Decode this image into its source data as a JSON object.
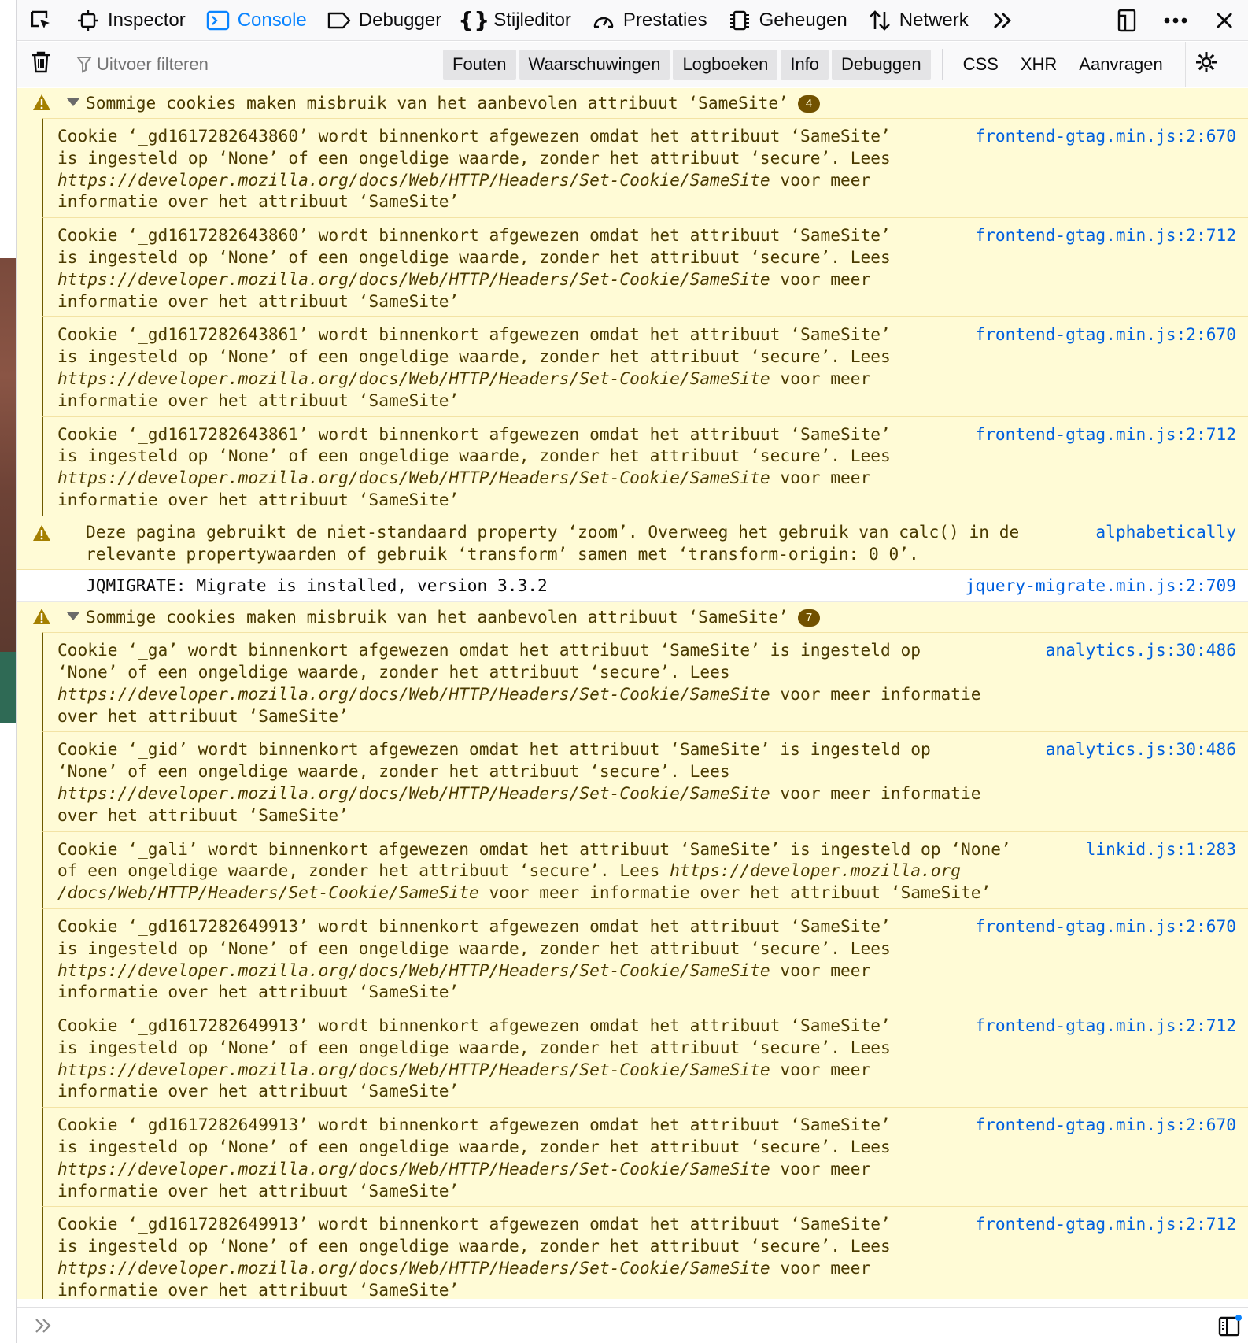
{
  "toolbar": {
    "tabs": [
      {
        "label": "Inspector",
        "icon": "inspector-icon"
      },
      {
        "label": "Console",
        "icon": "console-icon",
        "active": true
      },
      {
        "label": "Debugger",
        "icon": "debugger-icon"
      },
      {
        "label": "Stijleditor",
        "icon": "style-editor-icon"
      },
      {
        "label": "Prestaties",
        "icon": "performance-icon"
      },
      {
        "label": "Geheugen",
        "icon": "memory-icon"
      },
      {
        "label": "Netwerk",
        "icon": "network-icon"
      }
    ],
    "accent": "#0a84ff"
  },
  "filterbar": {
    "placeholder": "Uitvoer filteren",
    "levels": [
      "Fouten",
      "Waarschuwingen",
      "Logboeken",
      "Info",
      "Debuggen"
    ],
    "types": [
      "CSS",
      "XHR",
      "Aanvragen"
    ]
  },
  "output": {
    "group1": {
      "title": "Sommige cookies maken misbruik van het aanbevolen attribuut ‘SameSite’",
      "count": "4",
      "items": [
        {
          "lines": [
            "Cookie ‘_gd1617282643860’ wordt binnenkort afgewezen omdat het attribuut ‘SameSite’",
            "is ingesteld op ‘None’ of een ongeldige waarde, zonder het attribuut ‘secure’. Lees",
            "https://developer.mozilla.org/docs/Web/HTTP/Headers/Set-Cookie/SameSite",
            "informatie over het attribuut ‘SameSite’"
          ],
          "tail": " voor meer",
          "source": "frontend-gtag.min.js:2:670"
        },
        {
          "lines": [
            "Cookie ‘_gd1617282643860’ wordt binnenkort afgewezen omdat het attribuut ‘SameSite’",
            "is ingesteld op ‘None’ of een ongeldige waarde, zonder het attribuut ‘secure’. Lees",
            "https://developer.mozilla.org/docs/Web/HTTP/Headers/Set-Cookie/SameSite",
            "informatie over het attribuut ‘SameSite’"
          ],
          "tail": " voor meer",
          "source": "frontend-gtag.min.js:2:712"
        },
        {
          "lines": [
            "Cookie ‘_gd1617282643861’ wordt binnenkort afgewezen omdat het attribuut ‘SameSite’",
            "is ingesteld op ‘None’ of een ongeldige waarde, zonder het attribuut ‘secure’. Lees",
            "https://developer.mozilla.org/docs/Web/HTTP/Headers/Set-Cookie/SameSite",
            "informatie over het attribuut ‘SameSite’"
          ],
          "tail": " voor meer",
          "source": "frontend-gtag.min.js:2:670"
        },
        {
          "lines": [
            "Cookie ‘_gd1617282643861’ wordt binnenkort afgewezen omdat het attribuut ‘SameSite’",
            "is ingesteld op ‘None’ of een ongeldige waarde, zonder het attribuut ‘secure’. Lees",
            "https://developer.mozilla.org/docs/Web/HTTP/Headers/Set-Cookie/SameSite",
            "informatie over het attribuut ‘SameSite’"
          ],
          "tail": " voor meer",
          "source": "frontend-gtag.min.js:2:712"
        }
      ]
    },
    "zoom_warning": {
      "line1": "Deze pagina gebruikt de niet-standaard property ‘zoom’. Overweeg het gebruik van calc() in de",
      "line2": "relevante propertywaarden of gebruik ‘transform’ samen met ‘transform-origin: 0 0’.",
      "source": "alphabetically"
    },
    "jqmigrate": {
      "text": "JQMIGRATE: Migrate is installed, version 3.3.2",
      "source": "jquery-migrate.min.js:2:709"
    },
    "group2": {
      "title": "Sommige cookies maken misbruik van het aanbevolen attribuut ‘SameSite’",
      "count": "7",
      "items": [
        {
          "l1": "Cookie ‘_ga’ wordt binnenkort afgewezen omdat het attribuut ‘SameSite’ is ingesteld op",
          "l2": "‘None’ of een ongeldige waarde, zonder het attribuut ‘secure’. Lees",
          "url": "https://developer.mozilla.org/docs/Web/HTTP/Headers/Set-Cookie/SameSite",
          "tail": " voor meer informatie",
          "l4": "over het attribuut ‘SameSite’",
          "source": "analytics.js:30:486"
        },
        {
          "l1": "Cookie ‘_gid’ wordt binnenkort afgewezen omdat het attribuut ‘SameSite’ is ingesteld op",
          "l2": "‘None’ of een ongeldige waarde, zonder het attribuut ‘secure’. Lees",
          "url": "https://developer.mozilla.org/docs/Web/HTTP/Headers/Set-Cookie/SameSite",
          "tail": " voor meer informatie",
          "l4": "over het attribuut ‘SameSite’",
          "source": "analytics.js:30:486"
        }
      ],
      "gali": {
        "l1": "Cookie ‘_gali’ wordt binnenkort afgewezen omdat het attribuut ‘SameSite’ is ingesteld op ‘None’",
        "l2a": "of een ongeldige waarde, zonder het attribuut ‘secure’. Lees ",
        "l2url": "https://developer.mozilla.org",
        "l3url": "/docs/Web/HTTP/Headers/Set-Cookie/SameSite",
        "l3tail": " voor meer informatie over het attribuut ‘SameSite’",
        "source": "linkid.js:1:283"
      },
      "gd_items": [
        {
          "lines": [
            "Cookie ‘_gd1617282649913’ wordt binnenkort afgewezen omdat het attribuut ‘SameSite’",
            "is ingesteld op ‘None’ of een ongeldige waarde, zonder het attribuut ‘secure’. Lees",
            "https://developer.mozilla.org/docs/Web/HTTP/Headers/Set-Cookie/SameSite",
            "informatie over het attribuut ‘SameSite’"
          ],
          "tail": " voor meer",
          "source": "frontend-gtag.min.js:2:670"
        },
        {
          "lines": [
            "Cookie ‘_gd1617282649913’ wordt binnenkort afgewezen omdat het attribuut ‘SameSite’",
            "is ingesteld op ‘None’ of een ongeldige waarde, zonder het attribuut ‘secure’. Lees",
            "https://developer.mozilla.org/docs/Web/HTTP/Headers/Set-Cookie/SameSite",
            "informatie over het attribuut ‘SameSite’"
          ],
          "tail": " voor meer",
          "source": "frontend-gtag.min.js:2:712"
        },
        {
          "lines": [
            "Cookie ‘_gd1617282649913’ wordt binnenkort afgewezen omdat het attribuut ‘SameSite’",
            "is ingesteld op ‘None’ of een ongeldige waarde, zonder het attribuut ‘secure’. Lees",
            "https://developer.mozilla.org/docs/Web/HTTP/Headers/Set-Cookie/SameSite",
            "informatie over het attribuut ‘SameSite’"
          ],
          "tail": " voor meer",
          "source": "frontend-gtag.min.js:2:670"
        },
        {
          "lines": [
            "Cookie ‘_gd1617282649913’ wordt binnenkort afgewezen omdat het attribuut ‘SameSite’",
            "is ingesteld op ‘None’ of een ongeldige waarde, zonder het attribuut ‘secure’. Lees",
            "https://developer.mozilla.org/docs/Web/HTTP/Headers/Set-Cookie/SameSite",
            "informatie over het attribuut ‘SameSite’"
          ],
          "tail": " voor meer",
          "source": "frontend-gtag.min.js:2:712"
        }
      ]
    }
  },
  "colors": {
    "warning_bg": "#fffbd6",
    "warning_text": "#4a3a00",
    "link": "#0060df",
    "badge": "#715100"
  }
}
